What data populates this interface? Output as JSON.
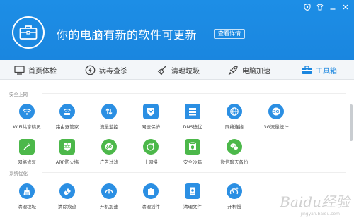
{
  "header": {
    "title": "你的电脑有新的软件可更新",
    "details_button": "查看详情",
    "controls": [
      "shield-icon",
      "shirt-icon",
      "minimize-icon",
      "close-icon"
    ],
    "colors": {
      "bg": "#1a86df",
      "text": "#ffffff"
    }
  },
  "nav": {
    "items": [
      {
        "label": "首页体检",
        "icon": "monitor-icon"
      },
      {
        "label": "病毒查杀",
        "icon": "lightning-circle-icon"
      },
      {
        "label": "清理垃圾",
        "icon": "broom-icon"
      },
      {
        "label": "电脑加速",
        "icon": "rocket-icon"
      },
      {
        "label": "工具箱",
        "icon": "toolbox-icon",
        "active": true
      }
    ],
    "accent": "#1a86df"
  },
  "sections": [
    {
      "title": "安全上网",
      "rows": [
        [
          {
            "label": "WiFi共享精灵",
            "icon": "wifi-icon",
            "color": "blue"
          },
          {
            "label": "路由器管家",
            "icon": "router-icon",
            "color": "blue"
          },
          {
            "label": "流量监控",
            "icon": "traffic-arrows-icon",
            "color": "blue"
          },
          {
            "label": "网速保护",
            "icon": "shield-chevron-icon",
            "color": "blue"
          },
          {
            "label": "DNS选优",
            "icon": "dns-server-icon",
            "color": "blue"
          },
          {
            "label": "网络连接",
            "icon": "globe-icon",
            "color": "blue"
          },
          {
            "label": "3G流量统计",
            "icon": "3g-icon",
            "color": "blue"
          }
        ],
        [
          {
            "label": "网络修复",
            "icon": "wrench-icon",
            "color": "green"
          },
          {
            "label": "ARP防火墙",
            "icon": "firewall-icon",
            "color": "green"
          },
          {
            "label": "广告过滤",
            "icon": "ad-block-icon",
            "color": "green"
          },
          {
            "label": "上网慢",
            "icon": "slow-network-icon",
            "color": "green"
          },
          {
            "label": "安全沙箱",
            "icon": "sandbox-icon",
            "color": "green"
          },
          {
            "label": "微信聊天备份",
            "icon": "wechat-icon",
            "color": "green"
          }
        ]
      ]
    },
    {
      "title": "系统优化",
      "rows": [
        [
          {
            "label": "清理垃圾",
            "icon": "broom-icon",
            "color": "blue"
          },
          {
            "label": "清除痕迹",
            "icon": "eraser-icon",
            "color": "blue"
          },
          {
            "label": "开机加速",
            "icon": "speedometer-icon",
            "color": "blue"
          },
          {
            "label": "清理插件",
            "icon": "puzzle-icon",
            "color": "blue"
          },
          {
            "label": "清理文件",
            "icon": "file-clean-icon",
            "color": "blue"
          },
          {
            "label": "开机慢",
            "icon": "slow-boot-icon",
            "color": "blue"
          }
        ]
      ]
    }
  ],
  "watermark": {
    "text": "Baidu经验",
    "sub": "jingyan.baidu.com"
  }
}
